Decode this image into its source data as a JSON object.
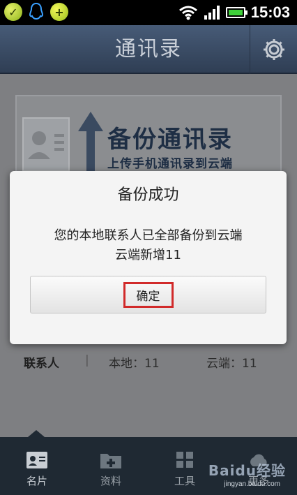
{
  "status_bar": {
    "time": "15:03"
  },
  "header": {
    "title": "通讯录"
  },
  "backup_card": {
    "heading": "备份通讯录",
    "subheading": "上传手机通讯录到云端"
  },
  "counts": {
    "contacts_label": "联系人",
    "separator": "|",
    "local": "本地：11",
    "cloud": "云端：11"
  },
  "dialog": {
    "title": "备份成功",
    "message_line1": "您的本地联系人已全部备份到云端",
    "message_line2": "云端新增11",
    "confirm_label": "确定"
  },
  "bottom_nav": {
    "items": [
      {
        "label": "名片",
        "icon": "card-icon",
        "active": true
      },
      {
        "label": "资料",
        "icon": "folder-plus-icon",
        "active": false
      },
      {
        "label": "工具",
        "icon": "grid-icon",
        "active": false
      },
      {
        "label": "更多",
        "icon": "cloud-icon",
        "active": false
      }
    ]
  },
  "watermark": {
    "text": "jingyan.baidu.com",
    "brand": "Baidu经验"
  },
  "colors": {
    "accent_highlight": "#d12a2a",
    "battery": "#3fd03a",
    "title_bar": "#3b4d66"
  }
}
